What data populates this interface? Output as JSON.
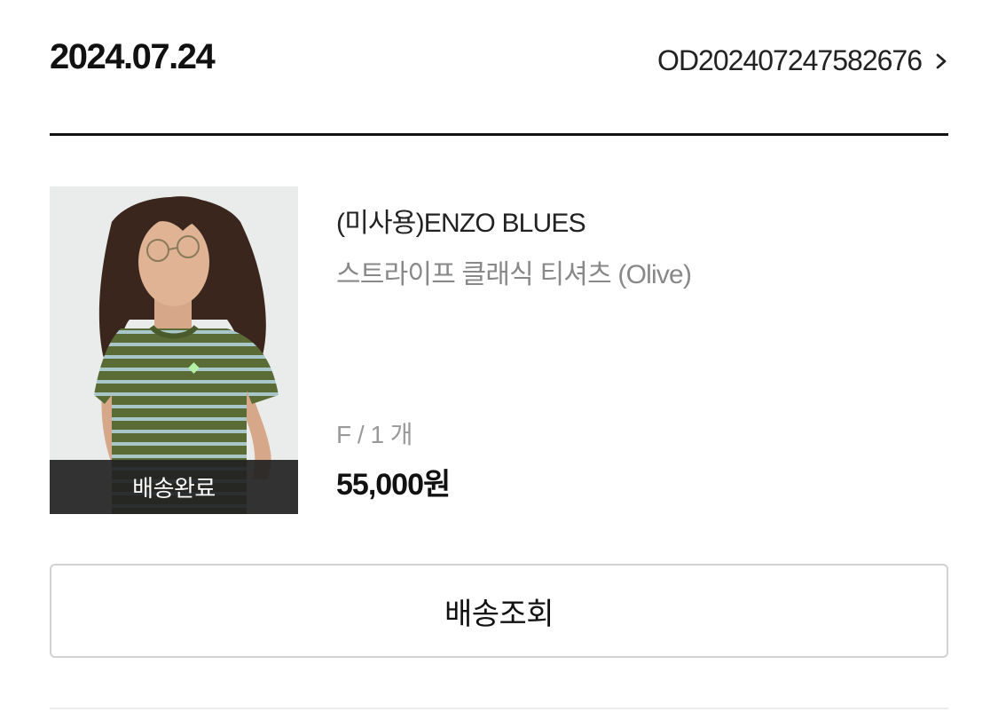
{
  "order": {
    "date": "2024.07.24",
    "order_number": "OD202407247582676"
  },
  "product": {
    "brand": "(미사용)ENZO BLUES",
    "name": "스트라이프 클래식 티셔츠 (Olive)",
    "option": "F / 1 개",
    "price": "55,000원",
    "status": "배송완료",
    "image_description": "model-wearing-olive-striped-tee"
  },
  "actions": {
    "track_label": "배송조회"
  },
  "icons": {
    "order_detail": "chevron-right-icon"
  },
  "colors": {
    "text_primary": "#111111",
    "text_secondary": "#888888",
    "text_muted": "#999999",
    "status_overlay": "#222222",
    "button_border": "#d2d2d2",
    "divider_light": "#ececec"
  }
}
